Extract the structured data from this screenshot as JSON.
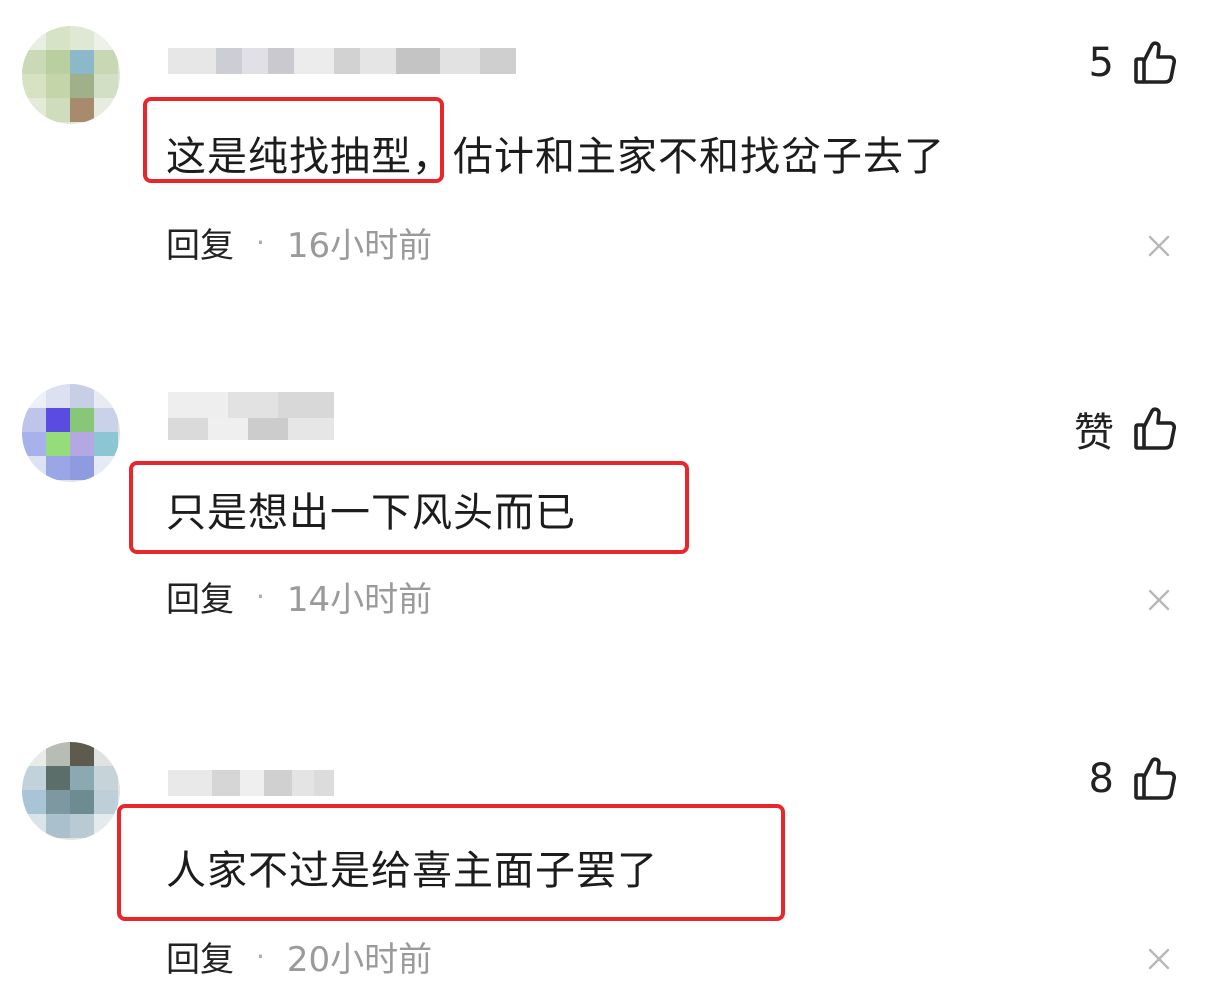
{
  "comments": [
    {
      "text": "这是纯找抽型，估计和主家不和找岔子去了",
      "like_label": "5",
      "reply_label": "回复",
      "separator": "·",
      "time": "16小时前"
    },
    {
      "text": "只是想出一下风头而已",
      "like_label": "赞",
      "reply_label": "回复",
      "separator": "·",
      "time": "14小时前"
    },
    {
      "text": "人家不过是给喜主面子罢了",
      "like_label": "8",
      "reply_label": "回复",
      "separator": "·",
      "time": "20小时前"
    }
  ],
  "colors": {
    "highlight": "#e8262b",
    "meta_time": "#9a9a9a"
  },
  "icons": {
    "like": "thumbs-up-icon",
    "close": "close-icon"
  }
}
